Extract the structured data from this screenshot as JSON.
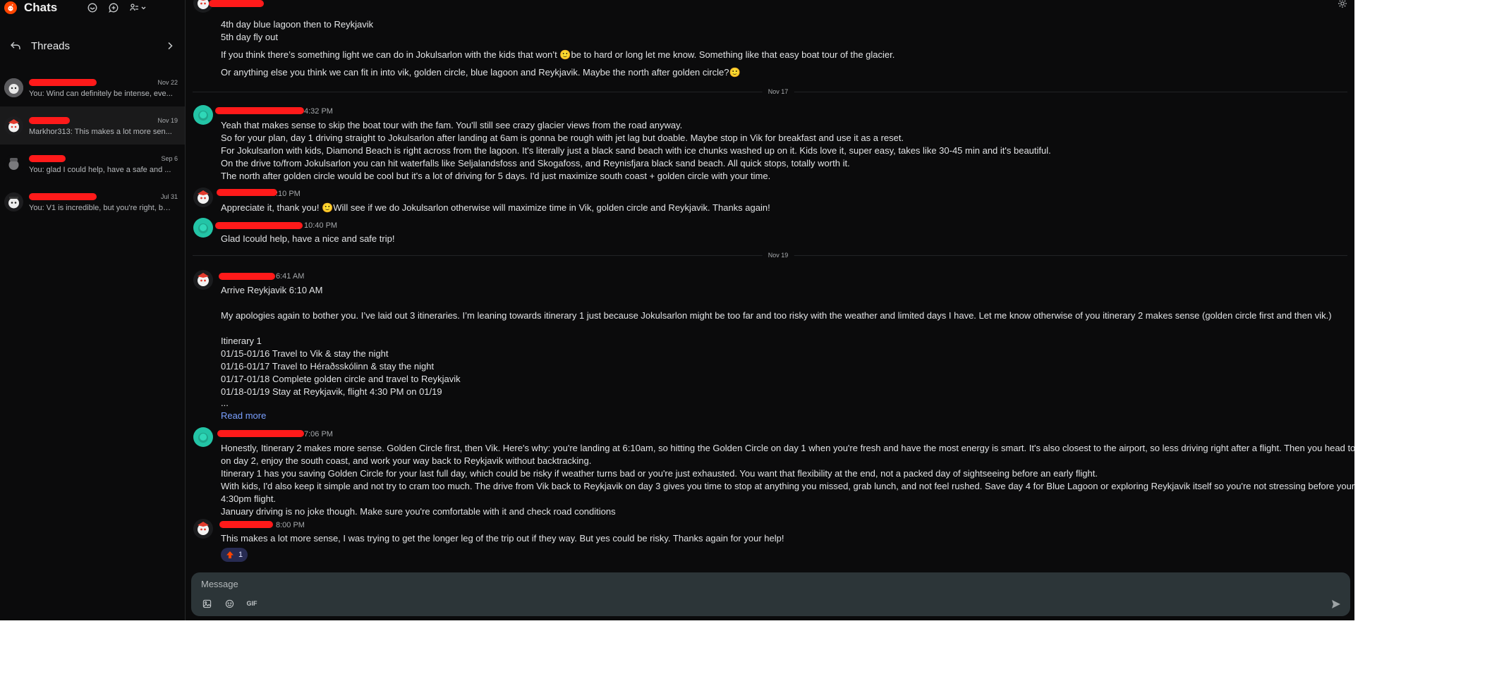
{
  "sidebar": {
    "title": "Chats",
    "threads_label": "Threads",
    "conversations": [
      {
        "date": "Nov 22",
        "preview": "You: Wind can definitely be intense, eve..."
      },
      {
        "date": "Nov 19",
        "preview": "Markhor313: This makes a lot more sen..."
      },
      {
        "date": "Sep 6",
        "preview": "You: glad I could help, have a safe and ..."
      },
      {
        "date": "Jul 31",
        "preview": "You: V1 is incredible, but you're right, bo..."
      }
    ]
  },
  "messages": {
    "top_lines": [
      "4th day blue lagoon then to Reykjavik",
      "5th day fly out",
      "If you think there’s something light we can do in Jokulsarlon with the kids that won’t 🙂be to hard or long let me know. Something like that easy boat tour of the glacier.",
      "Or anything else you think we can fit in into vik, golden circle, blue lagoon and Reykjavik. Maybe the north after golden circle?🙂"
    ],
    "date_nov17": "Nov 17",
    "m1": {
      "time": "4:32 PM",
      "lines": [
        "Yeah that makes sense to skip the boat tour with the fam. You'll still see crazy glacier views from the road anyway.",
        "So for your plan, day 1 driving straight to Jokulsarlon after landing at 6am is gonna be rough with jet lag but doable. Maybe stop in Vik for breakfast and use it as a reset.",
        "For Jokulsarlon with kids, Diamond Beach is right across from the lagoon. It's literally just a black sand beach with ice chunks washed up on it. Kids love it, super easy, takes like 30-45 min and it's beautiful.",
        "On the drive to/from Jokulsarlon you can hit waterfalls like Seljalandsfoss and Skogafoss, and Reynisfjara black sand beach. All quick stops, totally worth it.",
        "The north after golden circle would be cool but it's a lot of driving for 5 days. I'd just maximize south coast + golden circle with your time."
      ]
    },
    "m2": {
      "time": ":10 PM",
      "lines": [
        "Appreciate it, thank you! 🙂Will see if we do Jokulsarlon otherwise will maximize time in Vik, golden circle and Reykjavik. Thanks again!"
      ]
    },
    "m3": {
      "time": "10:40 PM",
      "lines": [
        "Glad Icould help, have a nice and safe trip!"
      ]
    },
    "date_nov19": "Nov 19",
    "m4": {
      "time": "6:41 AM",
      "lines": [
        "Arrive Reykjavik 6:10 AM",
        "My apologies again to bother you. I’ve laid out 3 itineraries. I’m leaning towards itinerary 1 just because Jokulsarlon might be too far and too risky with the weather and limited days I have. Let me know otherwise of you itinerary 2 makes sense (golden circle first and then vik.)",
        "Itinerary 1",
        "01/15-01/16 Travel to Vik & stay the night",
        "01/16-01/17 Travel to Héraðsskólinn & stay the night",
        "01/17-01/18 Complete golden circle and travel to Reykjavik",
        "01/18-01/19 Stay at Reykjavik, flight 4:30 PM on 01/19",
        "..."
      ],
      "read_more": "Read more"
    },
    "m5": {
      "time": "7:06 PM",
      "lines": [
        "Honestly, Itinerary 2 makes more sense. Golden Circle first, then Vik. Here's why: you're landing at 6:10am, so hitting the Golden Circle on day 1 when you're fresh and have the most energy is smart. It's also closest to the airport, so less driving right after a flight. Then you head to Vik",
        "on day 2, enjoy the south coast, and work your way back to Reykjavik without backtracking.",
        "Itinerary 1 has you saving Golden Circle for your last full day, which could be risky if weather turns bad or you're just exhausted. You want that flexibility at the end, not a packed day of sightseeing before an early flight.",
        "With kids, I'd also keep it simple and not try to cram too much. The drive from Vik back to Reykjavik on day 3 gives you time to stop at anything you missed, grab lunch, and not feel rushed. Save day 4 for Blue Lagoon or exploring Reykjavik itself so you're not stressing before your",
        "4:30pm flight.",
        "January driving is no joke though. Make sure you're comfortable with it and check road conditions"
      ]
    },
    "m6": {
      "time": "8:00 PM",
      "lines": [
        "This makes a lot more sense, I was trying to get the longer leg of the trip out if they way. But yes could be risky. Thanks again for your help!"
      ],
      "reaction_count": "1"
    }
  },
  "composer": {
    "placeholder": "Message",
    "gif_label": "GIF"
  },
  "colors": {
    "background": "#0b0b0c",
    "accent": "#ff4500",
    "link": "#7aa0ff",
    "redaction": "#ff1a1a",
    "teal_avatar": "#23c4a6"
  }
}
